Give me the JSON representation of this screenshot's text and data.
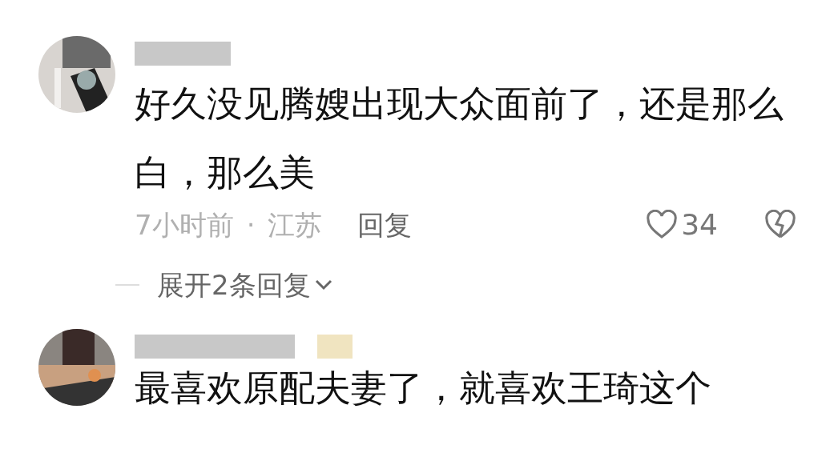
{
  "comments": [
    {
      "text": "好久没见腾嫂出现大众面前了，还是那么白，那么美",
      "time": "7小时前",
      "separator": "·",
      "location": "江苏",
      "reply_label": "回复",
      "liked": false,
      "likes": "34",
      "disliked": false,
      "expand": "展开2条回复"
    },
    {
      "text": "最喜欢原配夫妻了，就喜欢王琦这个"
    }
  ]
}
